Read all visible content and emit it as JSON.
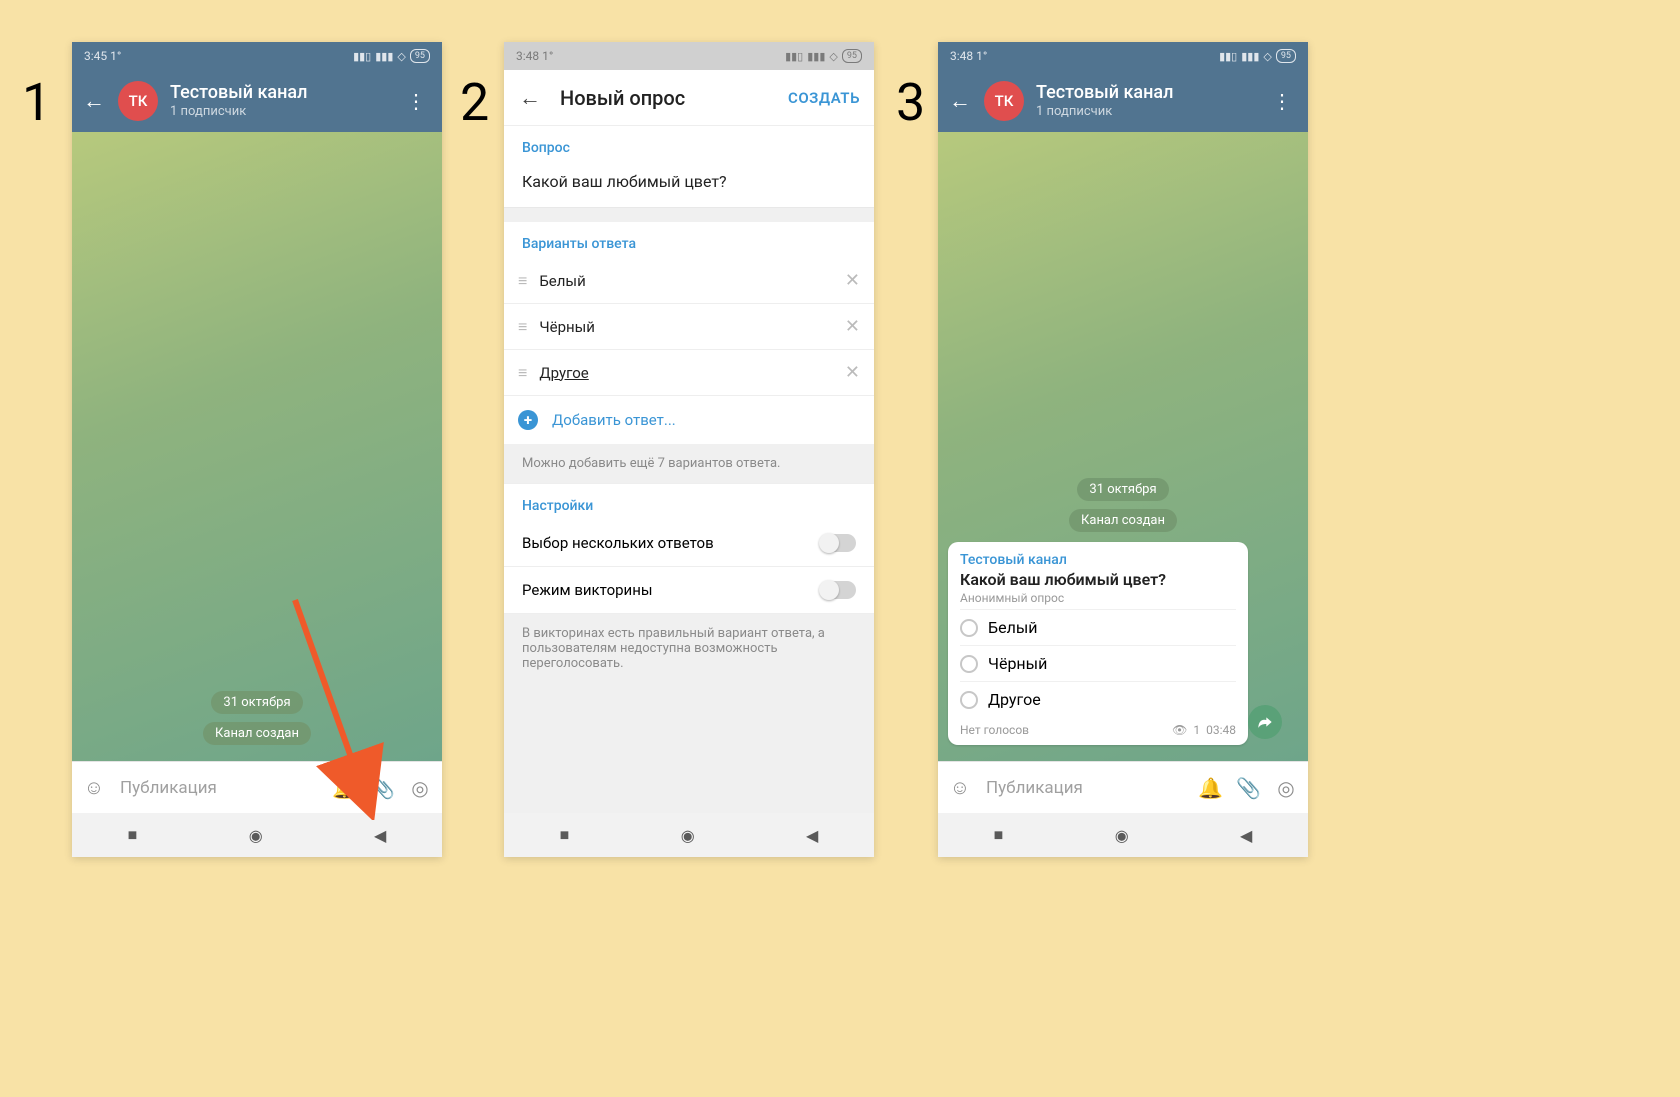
{
  "labels": {
    "step1": "1",
    "step2": "2",
    "step3": "3"
  },
  "screen1": {
    "status": {
      "time": "3:45 1°",
      "battery": "95"
    },
    "header": {
      "avatar": "ТК",
      "title": "Тестовый канал",
      "subtitle": "1 подписчик"
    },
    "chips": {
      "date": "31 октября",
      "created": "Канал создан"
    },
    "input": {
      "placeholder": "Публикация"
    }
  },
  "screen2": {
    "status": {
      "time": "3:48 1°",
      "battery": "95"
    },
    "header": {
      "title": "Новый опрос",
      "create": "СОЗДАТЬ"
    },
    "question": {
      "label": "Вопрос",
      "value": "Какой ваш любимый цвет?"
    },
    "answers": {
      "label": "Варианты ответа",
      "options": [
        "Белый",
        "Чёрный",
        "Другое"
      ],
      "add": "Добавить ответ...",
      "hint": "Можно добавить ещё 7 вариантов ответа."
    },
    "settings": {
      "label": "Настройки",
      "multi": "Выбор нескольких ответов",
      "quiz": "Режим викторины",
      "quiz_hint": "В викторинах есть правильный вариант ответа, а пользователям недоступна возможность переголосовать."
    }
  },
  "screen3": {
    "status": {
      "time": "3:48 1°",
      "battery": "95"
    },
    "header": {
      "avatar": "ТК",
      "title": "Тестовый канал",
      "subtitle": "1 подписчик"
    },
    "chips": {
      "date": "31 октября",
      "created": "Канал создан"
    },
    "poll": {
      "channel": "Тестовый канал",
      "question": "Какой ваш любимый цвет?",
      "anon": "Анонимный опрос",
      "options": [
        "Белый",
        "Чёрный",
        "Другое"
      ],
      "novotes": "Нет голосов",
      "views": "1",
      "time": "03:48"
    },
    "input": {
      "placeholder": "Публикация"
    }
  }
}
